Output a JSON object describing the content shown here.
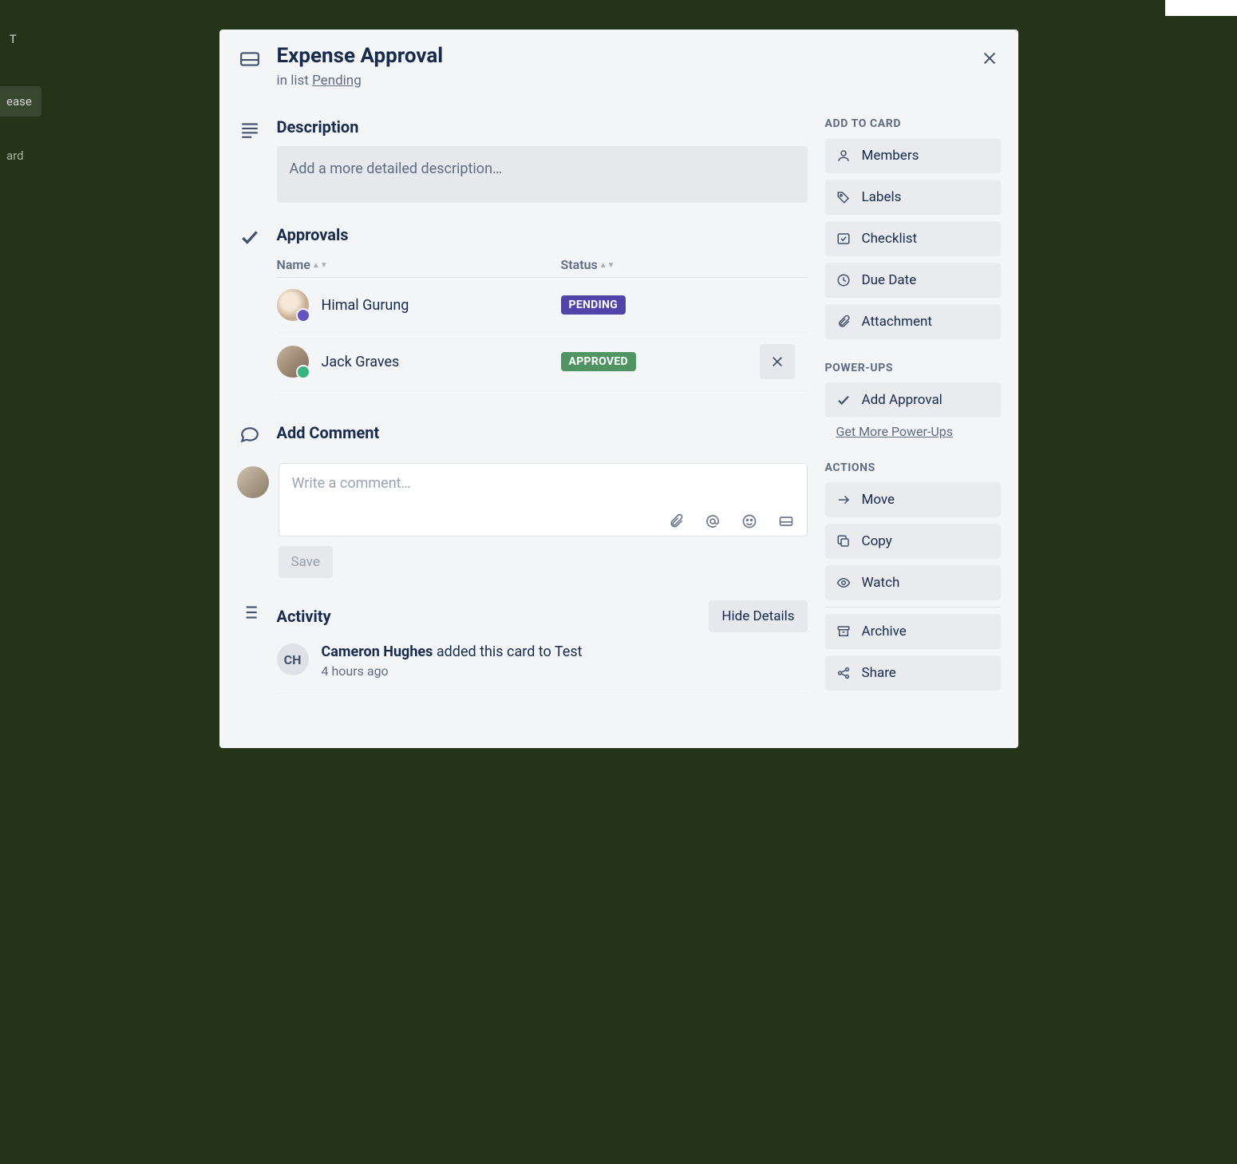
{
  "header": {
    "title": "Expense Approval",
    "inlist_prefix": "in list ",
    "list_name": "Pending"
  },
  "description": {
    "title": "Description",
    "placeholder": "Add a more detailed description…"
  },
  "approvals": {
    "title": "Approvals",
    "col_name": "Name",
    "col_status": "Status",
    "rows": [
      {
        "name": "Himal Gurung",
        "status": "PENDING"
      },
      {
        "name": "Jack Graves",
        "status": "APPROVED"
      }
    ]
  },
  "comment": {
    "title": "Add Comment",
    "placeholder": "Write a comment…",
    "save": "Save"
  },
  "activity": {
    "title": "Activity",
    "hide": "Hide Details",
    "entries": [
      {
        "initials": "CH",
        "actor": "Cameron Hughes",
        "rest": " added this card to Test",
        "time": "4 hours ago"
      }
    ]
  },
  "sidebar": {
    "add_to_card": "ADD TO CARD",
    "add_items": [
      "Members",
      "Labels",
      "Checklist",
      "Due Date",
      "Attachment"
    ],
    "powerups": "POWER-UPS",
    "add_approval": "Add Approval",
    "get_more": "Get More Power-Ups",
    "actions": "ACTIONS",
    "action_items": [
      "Move",
      "Copy",
      "Watch",
      "Archive",
      "Share"
    ]
  }
}
